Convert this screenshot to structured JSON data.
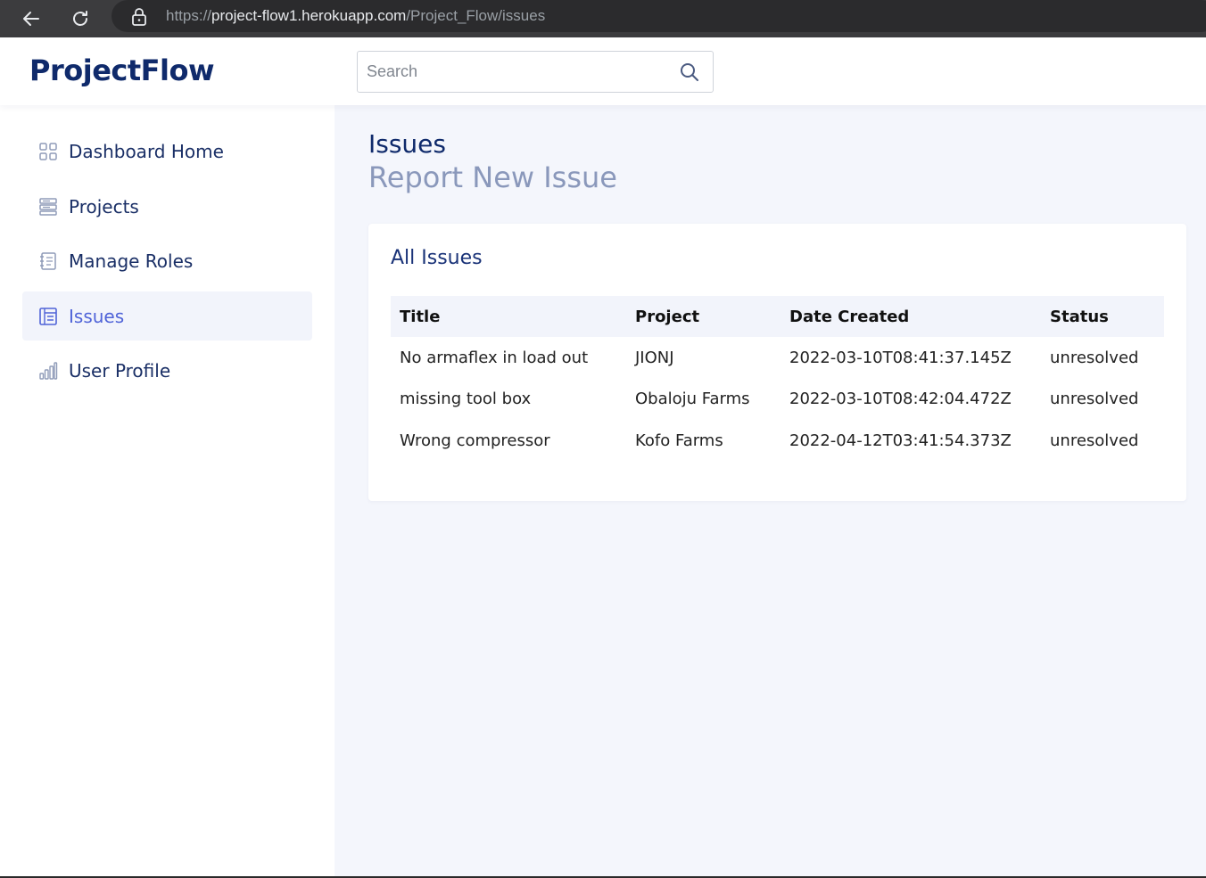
{
  "browser": {
    "url_scheme": "https://",
    "url_host": "project-flow1.herokuapp.com",
    "url_path": "/Project_Flow/issues"
  },
  "header": {
    "logo": "ProjectFlow",
    "search_placeholder": "Search"
  },
  "sidebar": {
    "items": [
      {
        "label": "Dashboard Home",
        "icon": "grid-icon"
      },
      {
        "label": "Projects",
        "icon": "layers-icon"
      },
      {
        "label": "Manage Roles",
        "icon": "notebook-icon"
      },
      {
        "label": "Issues",
        "icon": "table-icon",
        "active": true
      },
      {
        "label": "User Profile",
        "icon": "bar-chart-icon"
      }
    ]
  },
  "main": {
    "title": "Issues",
    "report_link": "Report New Issue",
    "card_title": "All Issues",
    "columns": [
      "Title",
      "Project",
      "Date Created",
      "Status"
    ],
    "rows": [
      {
        "title": "No armaflex in load out",
        "project": "JIONJ",
        "date": "2022-03-10T08:41:37.145Z",
        "status": "unresolved"
      },
      {
        "title": "missing tool box",
        "project": "Obaloju Farms",
        "date": "2022-03-10T08:42:04.472Z",
        "status": "unresolved"
      },
      {
        "title": "Wrong compressor",
        "project": "Kofo Farms",
        "date": "2022-04-12T03:41:54.373Z",
        "status": "unresolved"
      }
    ]
  },
  "colors": {
    "brand": "#0f2a6b",
    "active": "#4f63d8",
    "main_bg": "#f4f6fc"
  }
}
